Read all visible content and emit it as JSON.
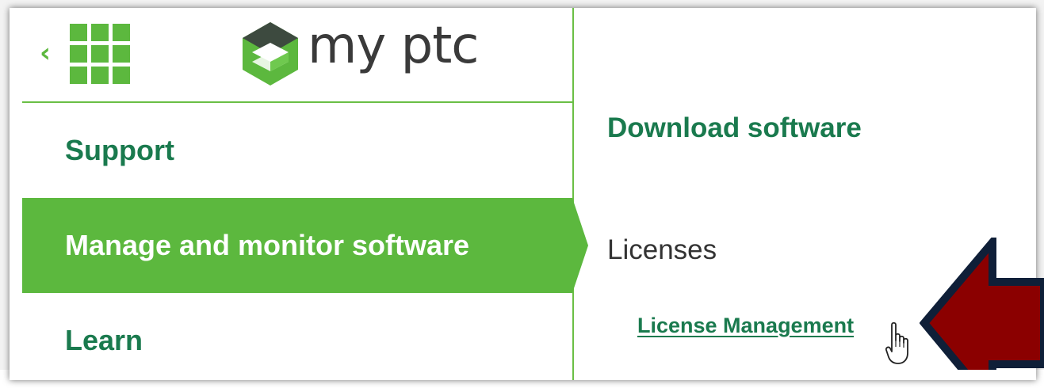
{
  "brand": {
    "back_icon_glyph": "‹",
    "apps_icon": "grid-icon",
    "logo_icon": "ptc-logo-icon",
    "logo_text": "my ptc"
  },
  "sidebar": {
    "items": [
      {
        "label": "Support",
        "active": false
      },
      {
        "label": "Manage and monitor software",
        "active": true
      },
      {
        "label": "Learn",
        "active": false
      }
    ]
  },
  "content": {
    "heading": "Download software",
    "section_title": "Licenses",
    "link_label": "License Management"
  },
  "annotation": {
    "arrow_icon": "callout-arrow-icon",
    "cursor_icon": "hand-pointer-icon"
  },
  "colors": {
    "brand_green": "#5cb83e",
    "dark_green_text": "#1a7a4e",
    "arrow_fill": "#8b0000",
    "arrow_outline": "#0f1f38"
  }
}
